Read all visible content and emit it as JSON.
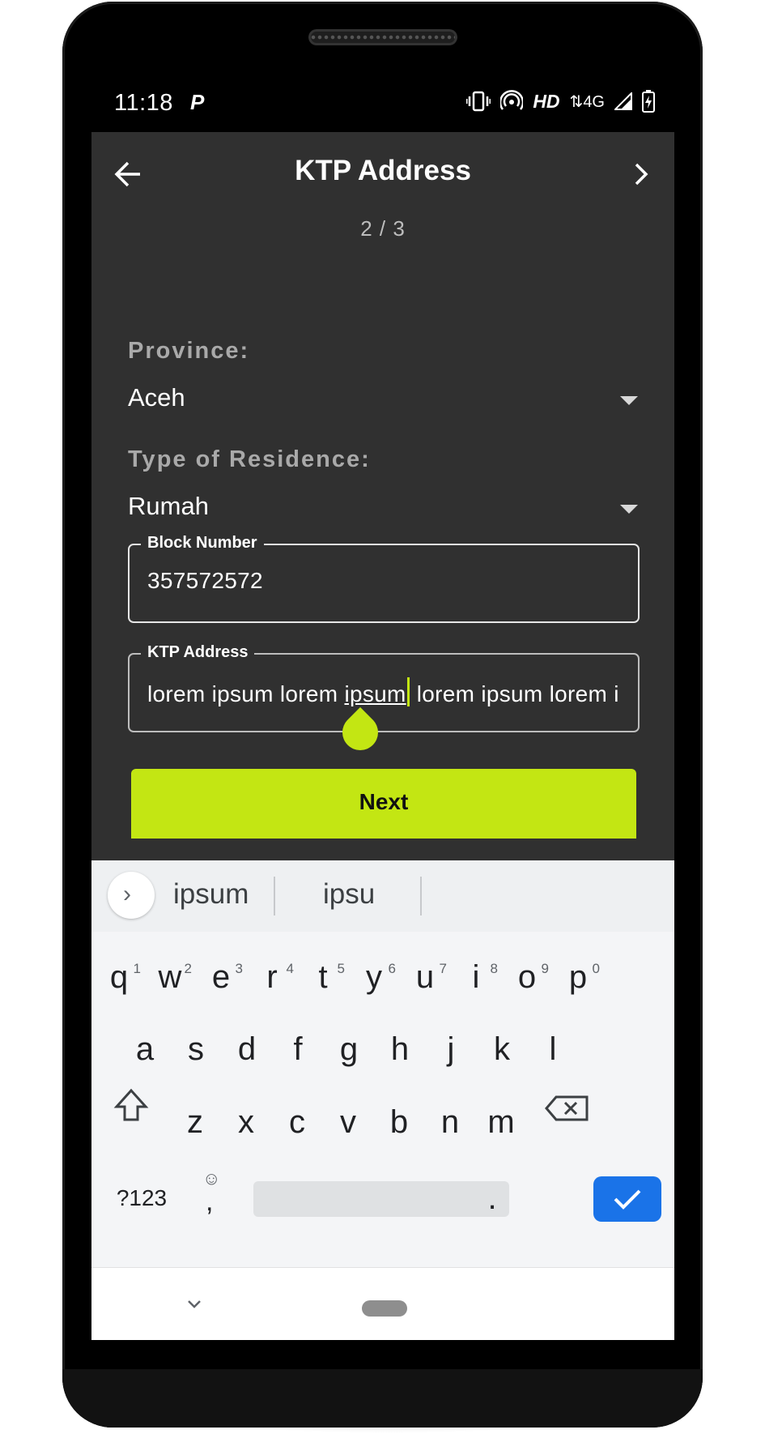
{
  "status": {
    "time": "11:18",
    "carrier_icon": "P",
    "hd": "HD",
    "network": "4G"
  },
  "app": {
    "title": "KTP Address",
    "step": "2 / 3",
    "province_label": "Province:",
    "province_value": "Aceh",
    "residence_label": "Type of Residence:",
    "residence_value": "Rumah",
    "block_label": "Block Number",
    "block_value": "357572572",
    "address_label": "KTP Address",
    "address_before": "lorem ipsum lorem ",
    "address_word": "ipsum",
    "address_after": " lorem ipsum lorem ip",
    "next_label": "Next",
    "accent_color": "#c3e613"
  },
  "keyboard": {
    "suggestions": [
      "ipsum",
      "ipsu"
    ],
    "row1": [
      {
        "k": "q",
        "n": "1"
      },
      {
        "k": "w",
        "n": "2"
      },
      {
        "k": "e",
        "n": "3"
      },
      {
        "k": "r",
        "n": "4"
      },
      {
        "k": "t",
        "n": "5"
      },
      {
        "k": "y",
        "n": "6"
      },
      {
        "k": "u",
        "n": "7"
      },
      {
        "k": "i",
        "n": "8"
      },
      {
        "k": "o",
        "n": "9"
      },
      {
        "k": "p",
        "n": "0"
      }
    ],
    "row2": [
      "a",
      "s",
      "d",
      "f",
      "g",
      "h",
      "j",
      "k",
      "l"
    ],
    "row3": [
      "z",
      "x",
      "c",
      "v",
      "b",
      "n",
      "m"
    ],
    "symbols_key": "?123",
    "comma_key": ",",
    "emoji_hint": "☺",
    "period_key": "."
  }
}
